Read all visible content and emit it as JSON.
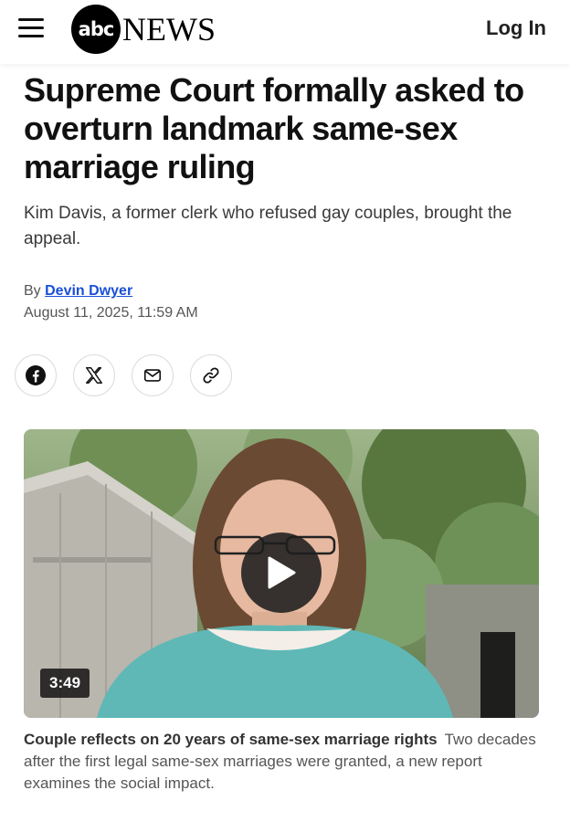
{
  "header": {
    "logo_abc": "abc",
    "logo_news": "NEWS",
    "login_label": "Log In"
  },
  "article": {
    "headline": "Supreme Court formally asked to overturn landmark same-sex marriage ruling",
    "subhead": "Kim Davis, a former clerk who refused gay couples, brought the appeal.",
    "byline_prefix": "By",
    "author": "Devin Dwyer",
    "date": "August 11, 2025, 11:59 AM"
  },
  "share": {
    "icons": [
      "facebook-icon",
      "x-icon",
      "email-icon",
      "link-icon"
    ]
  },
  "video": {
    "duration": "3:49",
    "caption_title": "Couple reflects on 20 years of same-sex marriage rights",
    "caption_text": "Two decades after the first legal same-sex marriages were granted, a new report examines the social impact."
  },
  "colors": {
    "author_link": "#1a4fd6",
    "text_primary": "#111111",
    "text_secondary": "#555555"
  }
}
